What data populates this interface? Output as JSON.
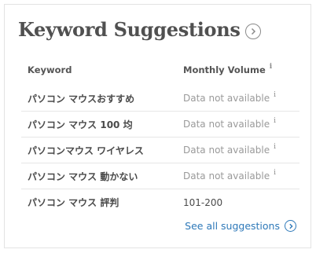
{
  "title": "Keyword Suggestions",
  "table": {
    "headers": {
      "keyword": "Keyword",
      "volume": "Monthly Volume"
    },
    "info_symbol": "i",
    "rows": [
      {
        "keyword": "パソコン マウスおすすめ",
        "volume": "Data not available"
      },
      {
        "keyword": "パソコン マウス 100 均",
        "volume": "Data not available"
      },
      {
        "keyword": "パソコンマウス ワイヤレス",
        "volume": "Data not available"
      },
      {
        "keyword": "パソコン マウス 動かない",
        "volume": "Data not available"
      },
      {
        "keyword": "パソコン マウス 評判",
        "volume": "101-200"
      }
    ]
  },
  "footer": {
    "see_all_label": "See all suggestions"
  },
  "icons": {
    "title_arrow": "chevron-right-circle-icon",
    "link_arrow": "chevron-right-circle-icon",
    "info": "info-icon"
  },
  "colors": {
    "title": "#505050",
    "link": "#2e79b9",
    "muted": "#9a9a9a"
  }
}
